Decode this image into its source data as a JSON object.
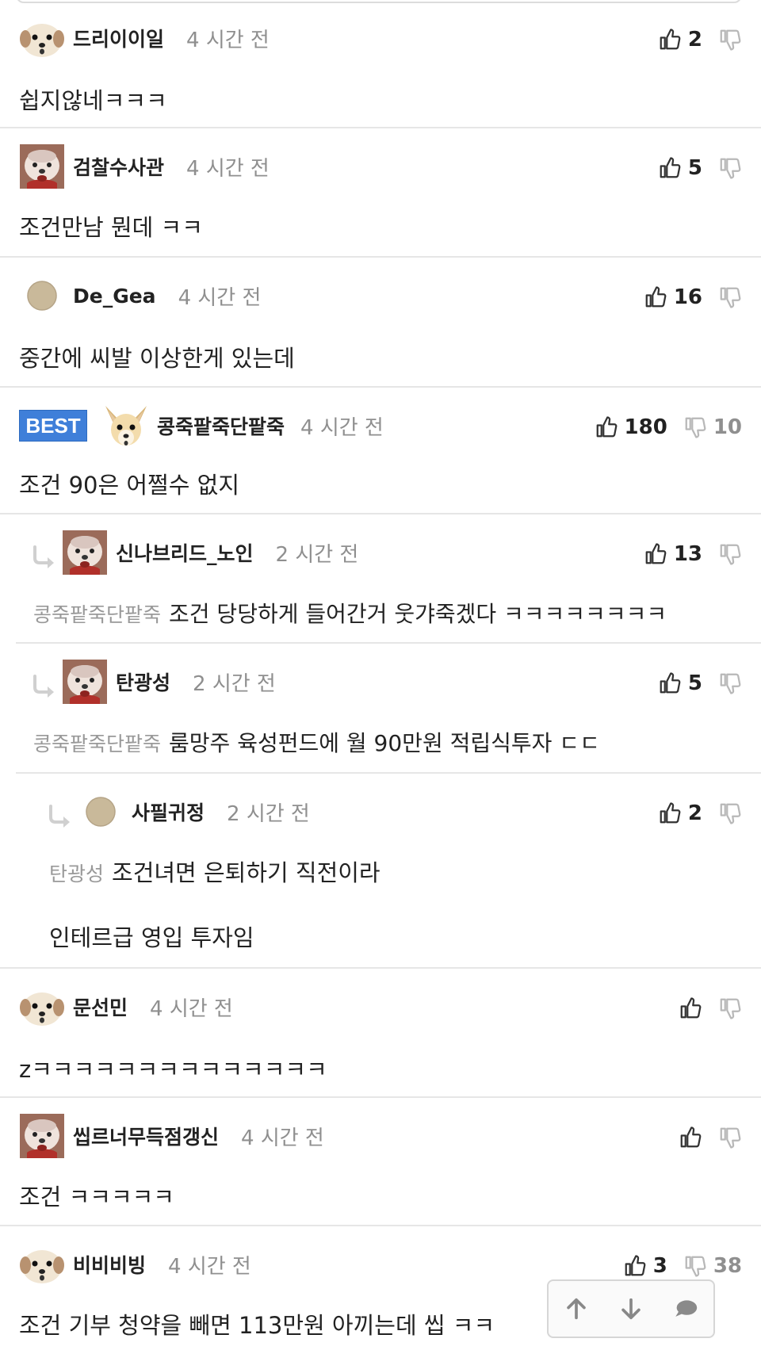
{
  "comments": [
    {
      "nick": "드리이이일",
      "time": "4 시간 전",
      "likes": "2",
      "dislikes": "",
      "text": "쉽지않네ㅋㅋㅋ",
      "avatar": "dog-face-avatar"
    },
    {
      "nick": "검찰수사관",
      "time": "4 시간 전",
      "likes": "5",
      "dislikes": "",
      "text": "조건만남 뭔데 ㅋㅋ",
      "avatar": "dog-red-collar-avatar"
    },
    {
      "nick": "De_Gea",
      "time": "4 시간 전",
      "likes": "16",
      "dislikes": "",
      "text": "중간에 씨발 이상한게 있는데",
      "avatar": "circle-avatar"
    },
    {
      "badge": "BEST",
      "nick": "콩죽팥죽단팥죽",
      "time": "4 시간 전",
      "likes": "180",
      "dislikes": "10",
      "text": "조건 90은 어쩔수 없지",
      "avatar": "chihuahua-avatar"
    },
    {
      "nick": "신나브리드_노인",
      "time": "2 시간 전",
      "likes": "13",
      "dislikes": "",
      "mention": "콩죽팥죽단팥죽",
      "text": "조건 당당하게 들어간거 웃갸죽겠다 ㅋㅋㅋㅋㅋㅋㅋㅋ",
      "avatar": "dog-red-collar-avatar"
    },
    {
      "nick": "탄광성",
      "time": "2 시간 전",
      "likes": "5",
      "dislikes": "",
      "mention": "콩죽팥죽단팥죽",
      "text": "룸망주 육성펀드에 월 90만원 적립식투자 ㄷㄷ",
      "avatar": "dog-red-collar-avatar"
    },
    {
      "nick": "사필귀정",
      "time": "2 시간 전",
      "likes": "2",
      "dislikes": "",
      "mention": "탄광성",
      "text": "조건녀면 은퇴하기 직전이라",
      "text2": "인테르급 영입 투자임",
      "avatar": "circle-avatar"
    },
    {
      "nick": "문선민",
      "time": "4 시간 전",
      "likes": "",
      "dislikes": "",
      "text": "zㅋㅋㅋㅋㅋㅋㅋㅋㅋㅋㅋㅋㅋㅋ",
      "avatar": "dog-face-avatar"
    },
    {
      "nick": "씹르너무득점갱신",
      "time": "4 시간 전",
      "likes": "",
      "dislikes": "",
      "text": "조건 ㅋㅋㅋㅋㅋ",
      "avatar": "dog-red-collar-avatar"
    },
    {
      "nick": "비비비빙",
      "time": "4 시간 전",
      "likes": "3",
      "dislikes": "38",
      "text": "조건 기부 청약을 빼면 113만원 아끼는데 씹 ㅋㅋ",
      "avatar": "dog-face-avatar"
    }
  ],
  "icons": {
    "like": "thumbs-up-icon",
    "dislike": "thumbs-down-icon",
    "reply": "reply-arrow-icon",
    "scroll_up": "arrow-up-icon",
    "scroll_down": "arrow-down-icon",
    "chat": "chat-bubble-icon"
  },
  "colors": {
    "best_badge": "#3f7fd9",
    "meta_gray": "#8f8f8f",
    "separator": "#e6e6e6"
  }
}
